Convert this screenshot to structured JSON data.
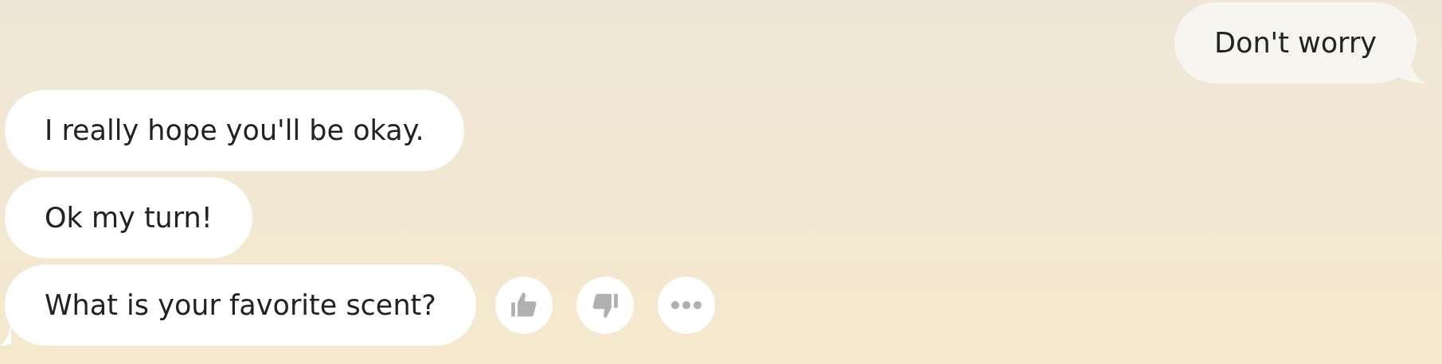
{
  "messages": [
    {
      "kind": "sent",
      "text": "Don't worry",
      "tail": true
    },
    {
      "kind": "received",
      "text": "I really hope you'll be okay.",
      "tail": false
    },
    {
      "kind": "received",
      "text": "Ok my turn!",
      "tail": false
    },
    {
      "kind": "received",
      "text": "What is your favorite scent?",
      "tail": true,
      "actions": [
        {
          "kind": "thumbs-up"
        },
        {
          "kind": "thumbs-down"
        },
        {
          "kind": "more"
        }
      ]
    }
  ]
}
